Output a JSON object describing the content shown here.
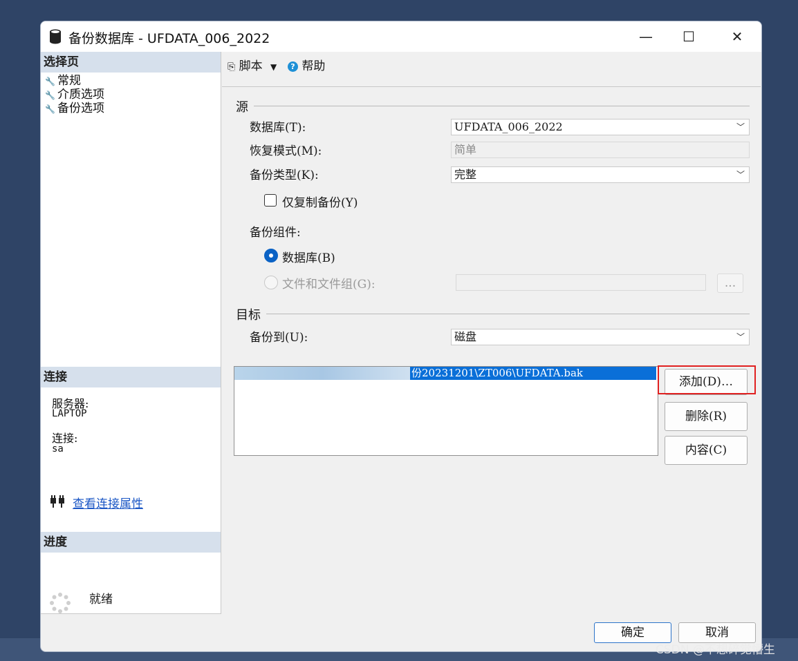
{
  "window": {
    "title": "备份数据库 - UFDATA_006_2022",
    "controls": {
      "minimize": "—",
      "maximize": "☐",
      "close": "✕"
    }
  },
  "left": {
    "select_page_header": "选择页",
    "pages": [
      "常规",
      "介质选项",
      "备份选项"
    ],
    "connection_header": "连接",
    "server_label": "服务器:",
    "server_value": "LAPTOP",
    "conn_label": "连接:",
    "conn_value": "sa",
    "view_props_link": "查看连接属性",
    "progress_header": "进度",
    "status": "就绪"
  },
  "toolbar": {
    "script_label": "脚本",
    "help_label": "帮助"
  },
  "source": {
    "group_title": "源",
    "database_label": "数据库(T):",
    "database_value": "UFDATA_006_2022",
    "recovery_label": "恢复模式(M):",
    "recovery_value": "简单",
    "backup_type_label": "备份类型(K):",
    "backup_type_value": "完整",
    "copy_only_label": "仅复制备份(Y)",
    "component_label": "备份组件:",
    "radio_database_label": "数据库(B)",
    "radio_files_label": "文件和文件组(G):",
    "browse_label": "..."
  },
  "target": {
    "group_title": "目标",
    "backup_to_label": "备份到(U):",
    "backup_to_value": "磁盘",
    "path_visible": "份20231201\\ZT006\\UFDATA.bak",
    "add_button": "添加(D)…",
    "remove_button": "删除(R)",
    "contents_button": "内容(C)"
  },
  "footer": {
    "ok": "确定",
    "cancel": "取消"
  },
  "watermark": "CSDN @不想碎觉懵生",
  "colors": {
    "accent": "#0a6fd8",
    "highlight": "#e02020",
    "header_bg": "#d6e0ec"
  }
}
